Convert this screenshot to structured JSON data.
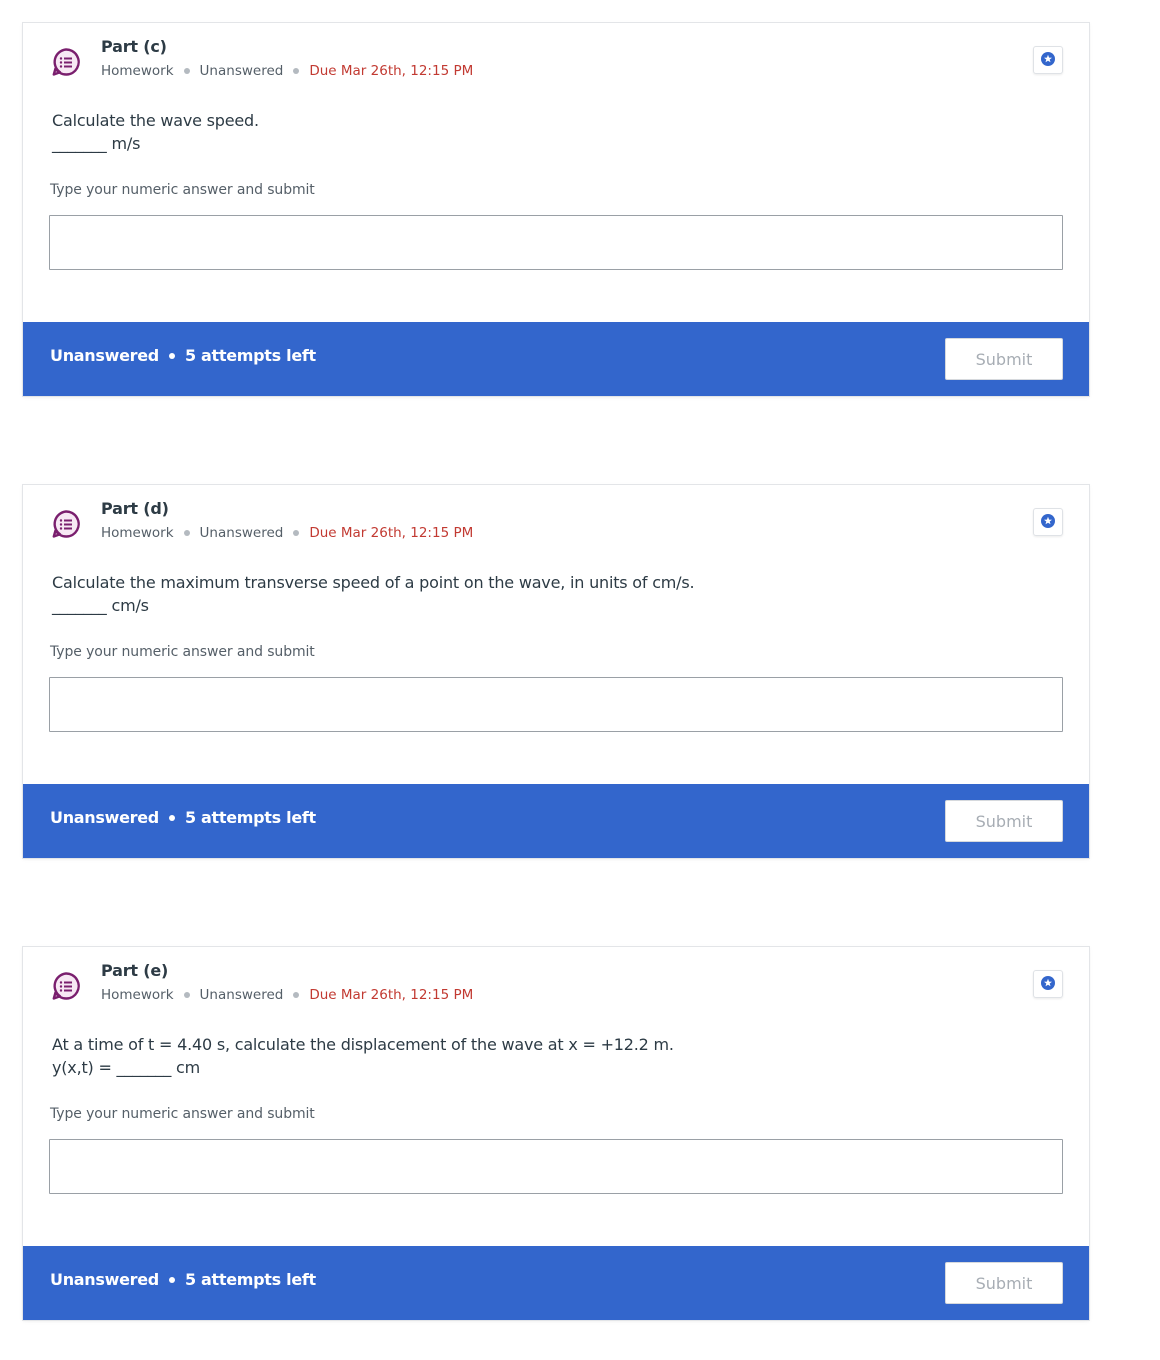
{
  "cards": [
    {
      "part_title": "Part (c)",
      "type": "Homework",
      "status": "Unanswered",
      "due": "Due Mar 26th, 12:15 PM",
      "question": "Calculate the wave speed.",
      "answer_line": "_______ m/s",
      "instruction": "Type your numeric answer and submit",
      "input_value": "",
      "footer_status": "Unanswered",
      "attempts": "5 attempts left",
      "submit_label": "Submit"
    },
    {
      "part_title": "Part (d)",
      "type": "Homework",
      "status": "Unanswered",
      "due": "Due Mar 26th, 12:15 PM",
      "question": "Calculate the maximum transverse speed of a point on the wave, in units of cm/s.",
      "answer_line": "_______ cm/s",
      "instruction": "Type your numeric answer and submit",
      "input_value": "",
      "footer_status": "Unanswered",
      "attempts": "5 attempts left",
      "submit_label": "Submit"
    },
    {
      "part_title": "Part (e)",
      "type": "Homework",
      "status": "Unanswered",
      "due": "Due Mar 26th, 12:15 PM",
      "question": "At a time of t = 4.40 s, calculate the displacement of the wave at x = +12.2 m.",
      "answer_line": "y(x,t) = _______ cm",
      "instruction": "Type your numeric answer and submit",
      "input_value": "",
      "footer_status": "Unanswered",
      "attempts": "5 attempts left",
      "submit_label": "Submit"
    }
  ],
  "icons": {
    "question": "question-list-icon",
    "star": "star-badge-icon"
  },
  "colors": {
    "footer_bg": "#3366cc",
    "due_text": "#c23a32",
    "icon_purple": "#7a1f6e",
    "star_blue": "#3366cc"
  }
}
